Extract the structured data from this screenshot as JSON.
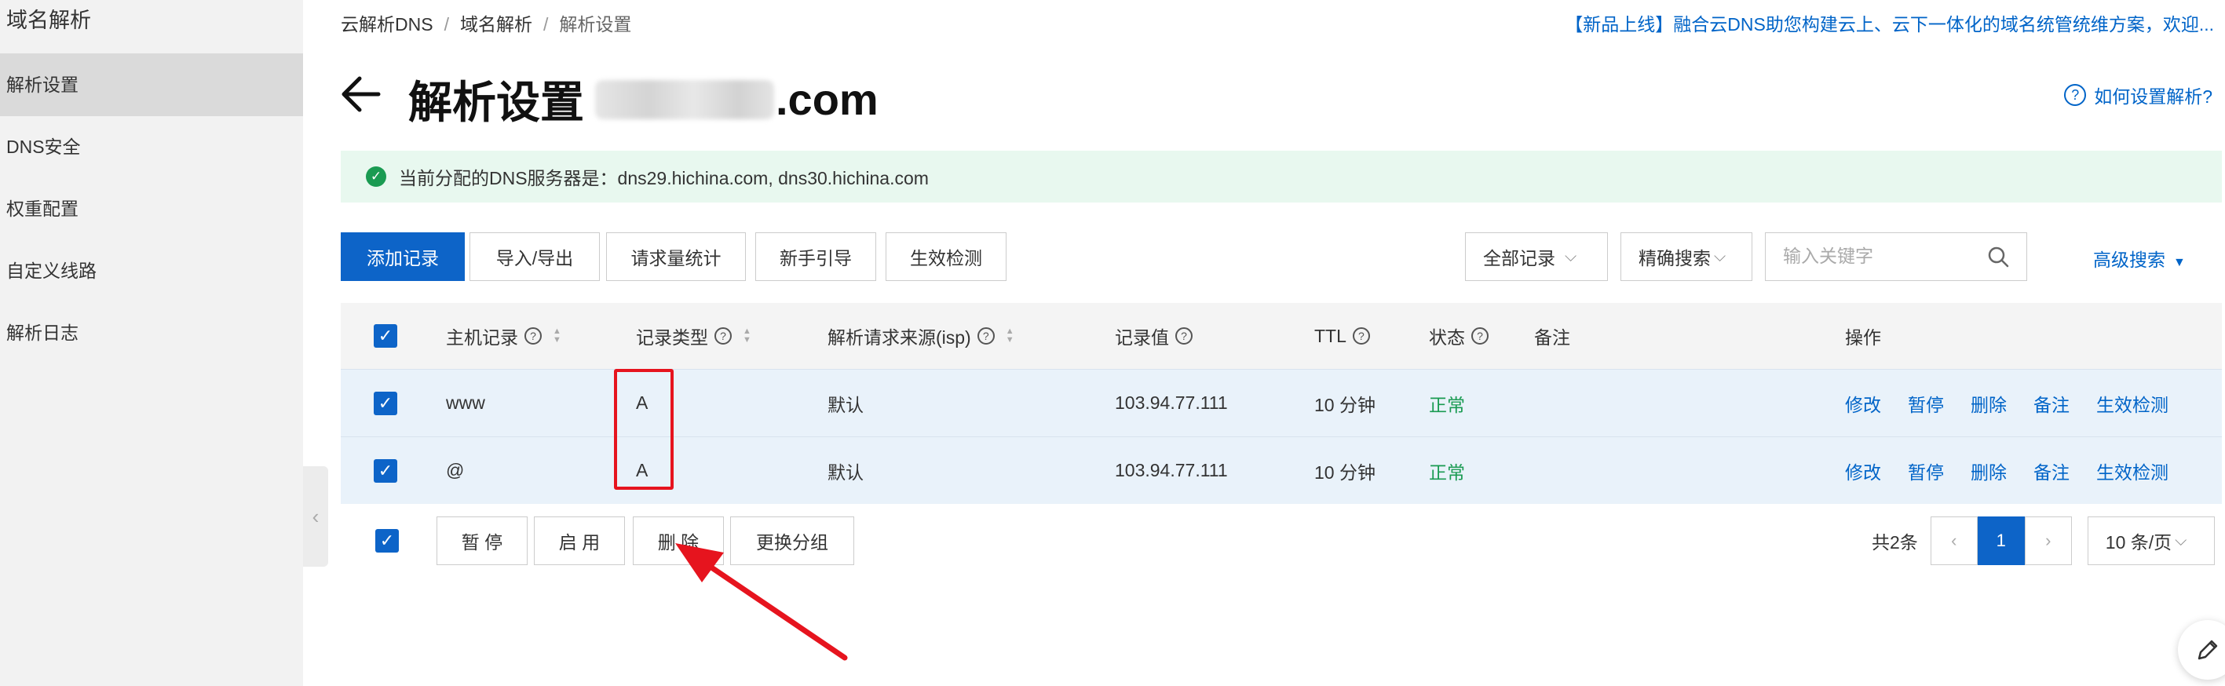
{
  "sidebar": {
    "title": "域名解析",
    "items": [
      {
        "label": "解析设置"
      },
      {
        "label": "DNS安全"
      },
      {
        "label": "权重配置"
      },
      {
        "label": "自定义线路"
      },
      {
        "label": "解析日志"
      }
    ]
  },
  "breadcrumb": [
    "云解析DNS",
    "域名解析",
    "解析设置"
  ],
  "announcement": "【新品上线】融合云DNS助您构建云上、云下一体化的域名统管统维方案，欢迎...",
  "title": {
    "prefix": "解析设置",
    "suffix": ".com"
  },
  "help_link": "如何设置解析?",
  "dns_notice": "当前分配的DNS服务器是：dns29.hichina.com, dns30.hichina.com",
  "toolbar": {
    "add_record": "添加记录",
    "import_export": "导入/导出",
    "request_stats": "请求量统计",
    "beginner_guide": "新手引导",
    "effect_check": "生效检测",
    "record_filter": "全部记录",
    "search_mode": "精确搜索",
    "search_placeholder": "输入关键字",
    "advanced_search": "高级搜索"
  },
  "table": {
    "headers": {
      "host": "主机记录",
      "type": "记录类型",
      "isp": "解析请求来源(isp)",
      "value": "记录值",
      "ttl": "TTL",
      "status": "状态",
      "remark": "备注",
      "actions": "操作"
    },
    "rows": [
      {
        "host": "www",
        "type": "A",
        "isp": "默认",
        "value": "103.94.77.111",
        "ttl": "10 分钟",
        "status": "正常",
        "remark": ""
      },
      {
        "host": "@",
        "type": "A",
        "isp": "默认",
        "value": "103.94.77.111",
        "ttl": "10 分钟",
        "status": "正常",
        "remark": ""
      }
    ],
    "row_actions": [
      "修改",
      "暂停",
      "删除",
      "备注",
      "生效检测"
    ]
  },
  "bulk": {
    "pause": "暂 停",
    "enable": "启 用",
    "delete": "删 除",
    "change_group": "更换分组"
  },
  "pagination": {
    "total": "共2条",
    "page": "1",
    "page_size": "10 条/页"
  },
  "colors": {
    "primary": "#0d64c8",
    "link": "#0064c8",
    "success": "#1a9b52",
    "highlight": "#e6141e",
    "notice_bg": "#e8f8ef"
  }
}
